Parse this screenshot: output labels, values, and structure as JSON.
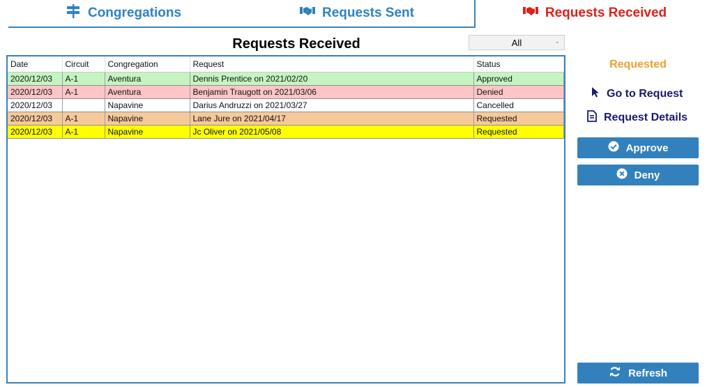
{
  "tabs": {
    "congregations": "Congregations",
    "sent": "Requests Sent",
    "received": "Requests Received"
  },
  "page": {
    "title": "Requests Received",
    "filter_value": "All"
  },
  "table": {
    "headers": [
      "Date",
      "Circuit",
      "Congregation",
      "Request",
      "Status"
    ],
    "rows": [
      {
        "date": "2020/12/03",
        "circuit": "A-1",
        "congregation": "Aventura",
        "request": "Dennis Prentice on 2021/02/20",
        "status": "Approved"
      },
      {
        "date": "2020/12/03",
        "circuit": "A-1",
        "congregation": "Aventura",
        "request": "Benjamin Traugott on 2021/03/06",
        "status": "Denied"
      },
      {
        "date": "2020/12/03",
        "circuit": "",
        "congregation": "Napavine",
        "request": "Darius Andruzzi on 2021/03/27",
        "status": "Cancelled"
      },
      {
        "date": "2020/12/03",
        "circuit": "A-1",
        "congregation": "Napavine",
        "request": "Lane Jure on 2021/04/17",
        "status": "Requested"
      },
      {
        "date": "2020/12/03",
        "circuit": "A-1",
        "congregation": "Napavine",
        "request": "Jc Oliver on 2021/05/08",
        "status": "Requested"
      }
    ]
  },
  "panel": {
    "status": "Requested",
    "goto_label": "Go to Request",
    "details_label": "Request Details",
    "approve_label": "Approve",
    "deny_label": "Deny",
    "refresh_label": "Refresh"
  },
  "colors": {
    "accent": "#3281bd",
    "active_tab": "#e0201b",
    "approved": "#c4f5c1",
    "denied": "#fdc5c5",
    "requested": "#f6c99b",
    "selected": "#ffff00",
    "status_label": "#f0a030"
  },
  "icons": {
    "congregations": "signpost-icon",
    "sent": "handshake-icon",
    "received": "handshake-icon",
    "goto": "cursor-arrow-icon",
    "details": "document-icon",
    "approve": "check-circle-icon",
    "deny": "x-circle-icon",
    "refresh": "sync-icon"
  }
}
